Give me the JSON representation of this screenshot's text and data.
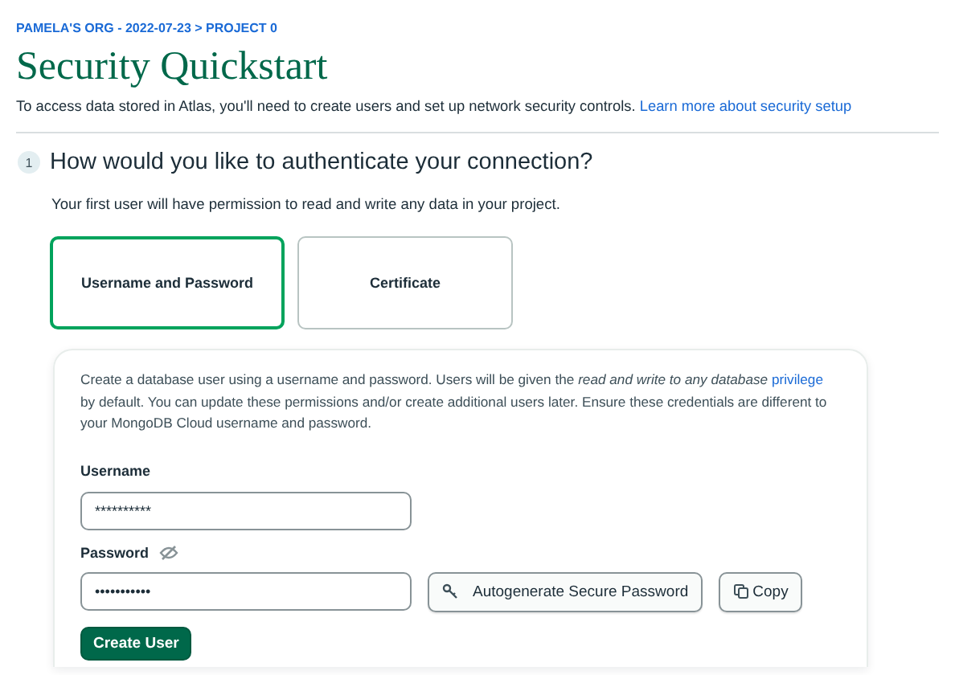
{
  "breadcrumb": "PAMELA'S ORG - 2022-07-23 > PROJECT 0",
  "title": "Security Quickstart",
  "intro": {
    "text": "To access data stored in Atlas, you'll need to create users and set up network security controls.",
    "link": "Learn more about security setup"
  },
  "step": {
    "number": "1",
    "question": "How would you like to authenticate your connection?",
    "subtitle": "Your first user will have permission to read and write any data in your project."
  },
  "auth_methods": [
    {
      "label": "Username and Password",
      "selected": true
    },
    {
      "label": "Certificate",
      "selected": false
    }
  ],
  "form": {
    "description_start": "Create a database user using a username and password. Users will be given the *read and write to any database*",
    "description_link": "privilege",
    "description_end": "by default. You can update these permissions and/or create additional users later. Ensure these credentials are different to your MongoDB Cloud username and password.",
    "username_label": "Username",
    "username_value": "**********",
    "password_label": "Password",
    "password_visible": false,
    "password_value": "•••••••••••",
    "autogenerate_button": "Autogenerate Secure Password",
    "copy_button": "Copy",
    "submit_button": "Create User"
  }
}
